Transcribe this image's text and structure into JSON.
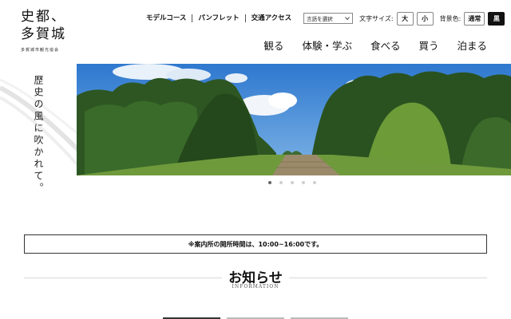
{
  "logo": {
    "line1": "史都、",
    "line2": "多賀城",
    "sub": "多賀城市観光協会"
  },
  "utility": {
    "links": [
      "モデルコース",
      "パンフレット",
      "交通アクセス"
    ],
    "language_select": "言語を選択",
    "font_size_label": "文字サイズ:",
    "font_large": "大",
    "font_small": "小",
    "bg_label": "背景色:",
    "bg_normal": "通常",
    "bg_black": "黒"
  },
  "nav": [
    "観る",
    "体験・学ぶ",
    "食べる",
    "買う",
    "泊まる"
  ],
  "hero": {
    "tagline": "歴史の風に吹かれて。",
    "slide_count": 5,
    "active_slide": 1
  },
  "notice": "※案内所の開所時間は、10:00~16:00です。",
  "news": {
    "title": "お知らせ",
    "subtitle": "INFORMATION"
  },
  "colors": {
    "sky": "#3f86d6",
    "foliage": "#2f5a23",
    "grass": "#6f9a3c",
    "text": "#1a1a1a"
  }
}
